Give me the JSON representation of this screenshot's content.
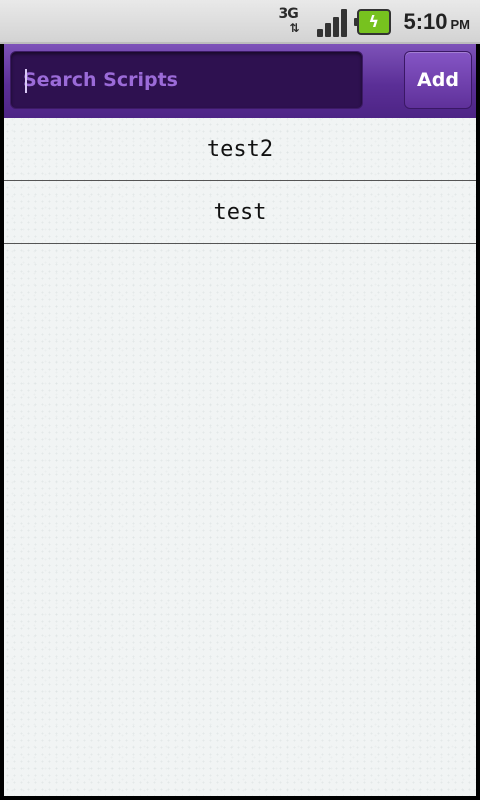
{
  "status_bar": {
    "network_type": "3G",
    "time": "5:10",
    "ampm": "PM"
  },
  "header": {
    "search_placeholder": "Search Scripts",
    "search_value": "",
    "add_label": "Add"
  },
  "scripts": [
    {
      "name": "test2"
    },
    {
      "name": "test"
    }
  ],
  "colors": {
    "header_top": "#7e53b9",
    "header_bottom": "#4d2485",
    "search_bg": "#2e1150",
    "placeholder": "#9b6bd8",
    "list_bg": "#f1f4f4"
  }
}
